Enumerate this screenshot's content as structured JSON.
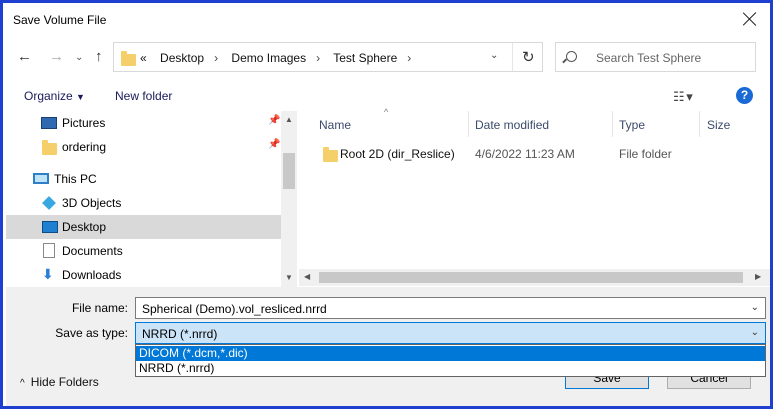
{
  "window": {
    "title": "Save Volume File"
  },
  "nav": {
    "back_glyph": "←",
    "forward_glyph": "→",
    "up_glyph": "↑",
    "recent_glyph": "⌄",
    "breadcrumb": [
      "«",
      "Desktop",
      "Demo Images",
      "Test Sphere"
    ],
    "search_placeholder": "Search Test Sphere"
  },
  "toolbar": {
    "organize": "Organize",
    "new_folder": "New folder",
    "help": "?"
  },
  "nav_pane": {
    "items": [
      {
        "label": "Pictures",
        "icon": "pictures-icon",
        "pinned": true
      },
      {
        "label": "ordering",
        "icon": "folder-icon",
        "pinned": true
      },
      {
        "label": "This PC",
        "icon": "computer-icon"
      },
      {
        "label": "3D Objects",
        "icon": "3d-objects-icon"
      },
      {
        "label": "Desktop",
        "icon": "desktop-icon",
        "selected": true
      },
      {
        "label": "Documents",
        "icon": "documents-icon"
      },
      {
        "label": "Downloads",
        "icon": "downloads-icon"
      }
    ]
  },
  "file_list": {
    "columns": [
      "Name",
      "Date modified",
      "Type",
      "Size"
    ],
    "rows": [
      {
        "name": "Root 2D (dir_Reslice)",
        "date": "4/6/2022 11:23 AM",
        "type": "File folder",
        "size": ""
      }
    ]
  },
  "form": {
    "file_name_label": "File name:",
    "file_name_value": "Spherical (Demo).vol_resliced.nrrd",
    "save_type_label": "Save as type:",
    "save_type_value": "NRRD (*.nrrd)",
    "save_type_options": [
      "DICOM (*.dcm,*.dic)",
      "NRRD (*.nrrd)"
    ],
    "highlighted_option": 0
  },
  "footer": {
    "hide_folders": "Hide Folders",
    "save": "Save",
    "cancel": "Cancel"
  },
  "colors": {
    "accent": "#0078d7",
    "frame": "#1f3fd1",
    "selection": "#d9d9d9"
  }
}
